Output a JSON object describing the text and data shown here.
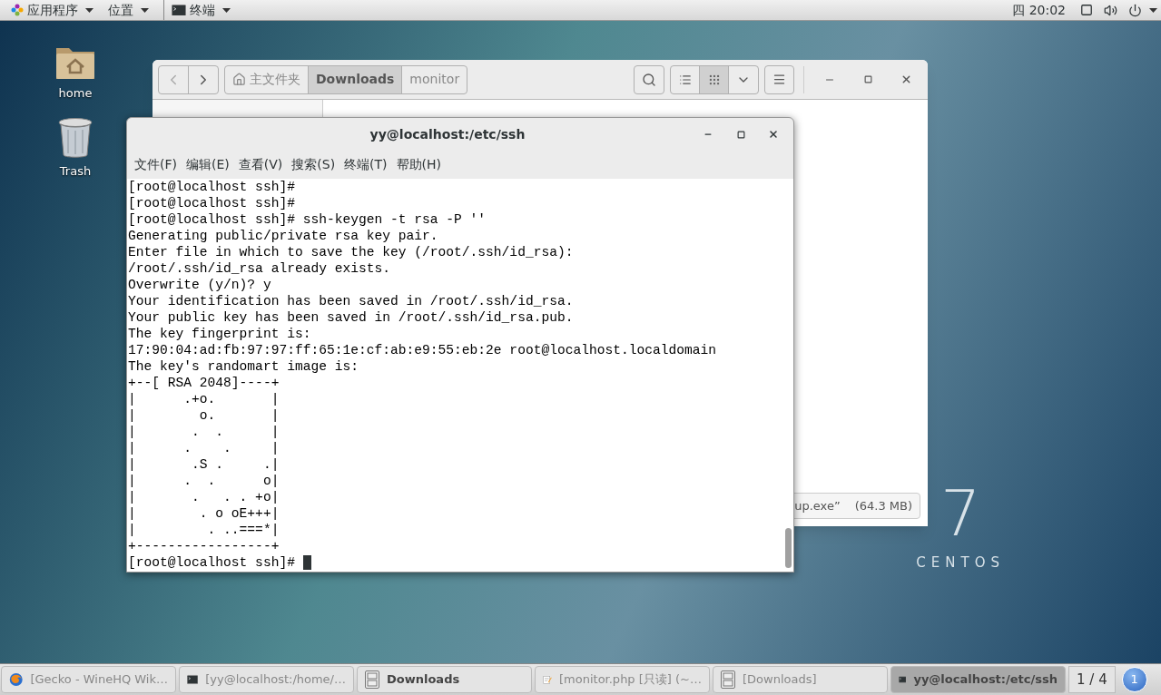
{
  "top_bar": {
    "menus": [
      {
        "label": "应用程序",
        "kind": "apps"
      },
      {
        "label": "位置",
        "kind": "places"
      },
      {
        "label": "终端",
        "kind": "terminal"
      }
    ],
    "clock": "四 20:02"
  },
  "desktop_icons": [
    {
      "label": "home",
      "kind": "home"
    },
    {
      "label": "Trash",
      "kind": "trash"
    }
  ],
  "file_manager": {
    "path": [
      {
        "label": "主文件夹",
        "kind": "home",
        "selected": false
      },
      {
        "label": "Downloads",
        "kind": "folder",
        "selected": true
      },
      {
        "label": "monitor",
        "kind": "folder",
        "selected": false
      }
    ],
    "views": [
      {
        "kind": "list",
        "selected": false
      },
      {
        "kind": "grid",
        "selected": true
      }
    ],
    "status": {
      "name": "up.exe”",
      "size": "(64.3 MB)"
    }
  },
  "terminal": {
    "title": "yy@localhost:/etc/ssh",
    "menu": [
      "文件(F)",
      "编辑(E)",
      "查看(V)",
      "搜索(S)",
      "终端(T)",
      "帮助(H)"
    ],
    "lines": [
      "[root@localhost ssh]#",
      "[root@localhost ssh]#",
      "[root@localhost ssh]# ssh-keygen -t rsa -P ''",
      "Generating public/private rsa key pair.",
      "Enter file in which to save the key (/root/.ssh/id_rsa):",
      "/root/.ssh/id_rsa already exists.",
      "Overwrite (y/n)? y",
      "Your identification has been saved in /root/.ssh/id_rsa.",
      "Your public key has been saved in /root/.ssh/id_rsa.pub.",
      "The key fingerprint is:",
      "17:90:04:ad:fb:97:97:ff:65:1e:cf:ab:e9:55:eb:2e root@localhost.localdomain",
      "The key's randomart image is:",
      "+--[ RSA 2048]----+",
      "|      .+o.       |",
      "|        o.       |",
      "|       .  .      |",
      "|      .    .     |",
      "|       .S .     .|",
      "|      .  .      o|",
      "|       .   . . +o|",
      "|        . o oE+++|",
      "|         . ..===*|",
      "+-----------------+",
      "[root@localhost ssh]# "
    ],
    "cursor": true
  },
  "logo": {
    "number": "7",
    "name": "CENTOS"
  },
  "taskbar": {
    "items": [
      {
        "label": "[Gecko - WineHQ Wik…",
        "kind": "browser",
        "minimized": true,
        "selected": false
      },
      {
        "label": "[yy@localhost:/home/…",
        "kind": "terminal",
        "minimized": true,
        "selected": false
      },
      {
        "label": "Downloads",
        "kind": "files",
        "minimized": false,
        "selected": false
      },
      {
        "label": "[monitor.php [只读] (~…",
        "kind": "editor",
        "minimized": true,
        "selected": false
      },
      {
        "label": "[Downloads]",
        "kind": "files",
        "minimized": true,
        "selected": false
      },
      {
        "label": "yy@localhost:/etc/ssh",
        "kind": "terminal",
        "minimized": false,
        "selected": true
      }
    ],
    "pager": "1 / 4",
    "notifications": "1"
  }
}
